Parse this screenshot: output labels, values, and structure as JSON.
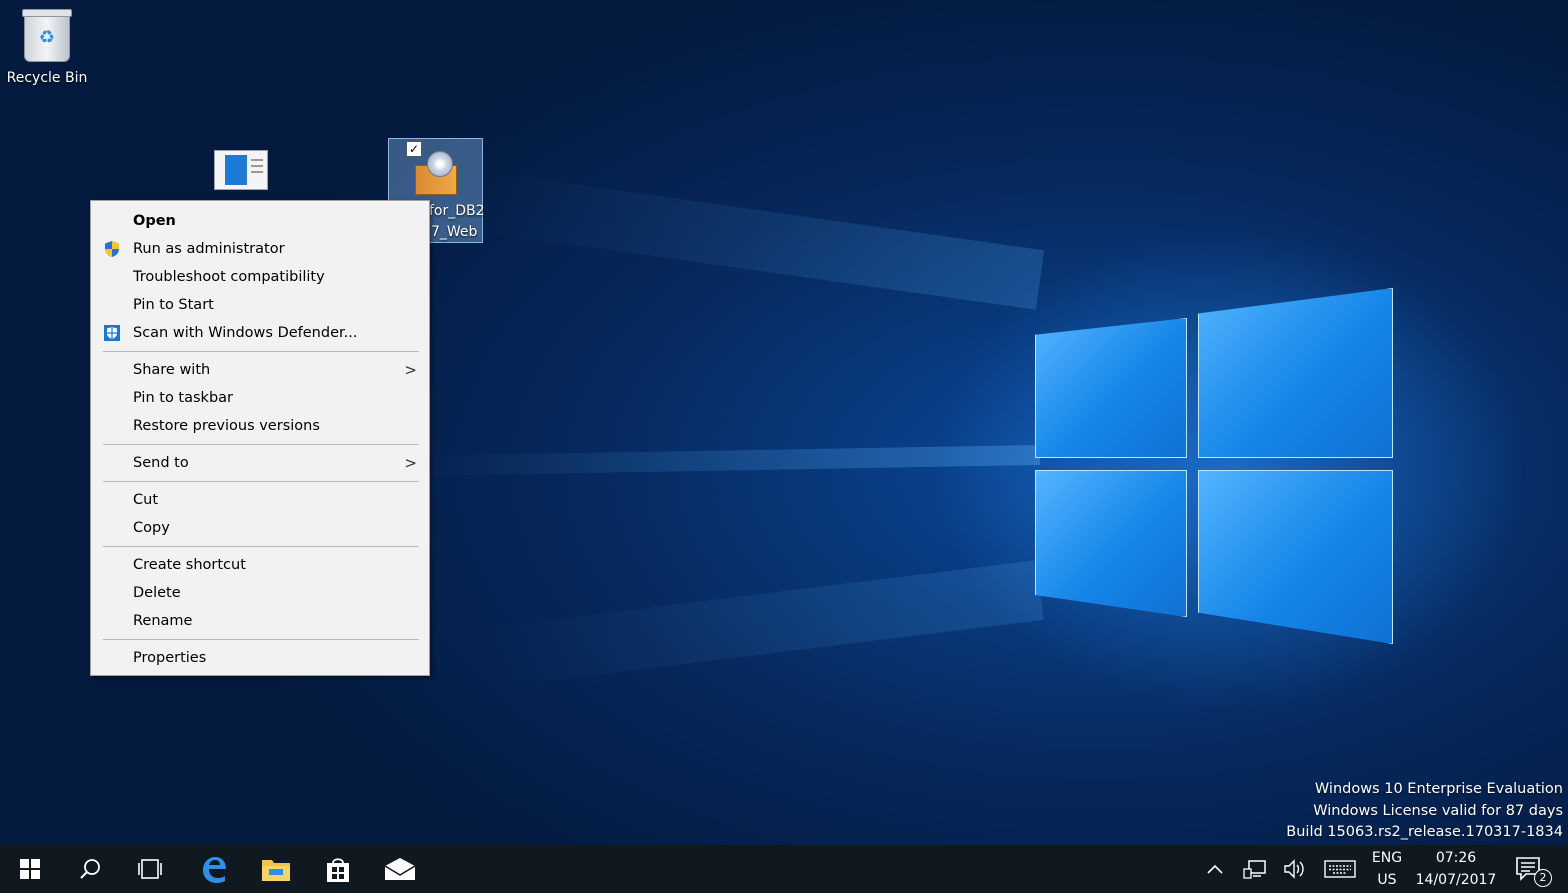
{
  "desktop": {
    "recycle_bin_label": "Recycle Bin",
    "selected_icon_label_line1": "for_DB2",
    "selected_icon_label_line2": "7_Web"
  },
  "context_menu": {
    "items": [
      {
        "label": "Open",
        "bold": true
      },
      {
        "label": "Run as administrator",
        "icon": "uac-shield-icon"
      },
      {
        "label": "Troubleshoot compatibility"
      },
      {
        "label": "Pin to Start"
      },
      {
        "label": "Scan with Windows Defender...",
        "icon": "windows-defender-icon"
      },
      {
        "label": "Share with",
        "submenu": true
      },
      {
        "label": "Pin to taskbar"
      },
      {
        "label": "Restore previous versions"
      },
      {
        "label": "Send to",
        "submenu": true
      },
      {
        "label": "Cut"
      },
      {
        "label": "Copy"
      },
      {
        "label": "Create shortcut"
      },
      {
        "label": "Delete"
      },
      {
        "label": "Rename"
      },
      {
        "label": "Properties"
      }
    ],
    "submenu_arrow": ">"
  },
  "watermark": {
    "line1": "Windows 10 Enterprise Evaluation",
    "line2": "Windows License valid for 87 days",
    "line3": "Build 15063.rs2_release.170317-1834"
  },
  "taskbar": {
    "pinned": [
      "start-icon",
      "search-icon",
      "task-view-icon",
      "edge-icon",
      "file-explorer-icon",
      "store-icon",
      "mail-icon"
    ],
    "tray": {
      "language_line1": "ENG",
      "language_line2": "US",
      "time": "07:26",
      "date": "14/07/2017",
      "notification_count": "2"
    }
  },
  "colors": {
    "taskbar": "#101820",
    "menu_bg": "#f2f2f2",
    "desktop_accent": "#1686e8"
  }
}
